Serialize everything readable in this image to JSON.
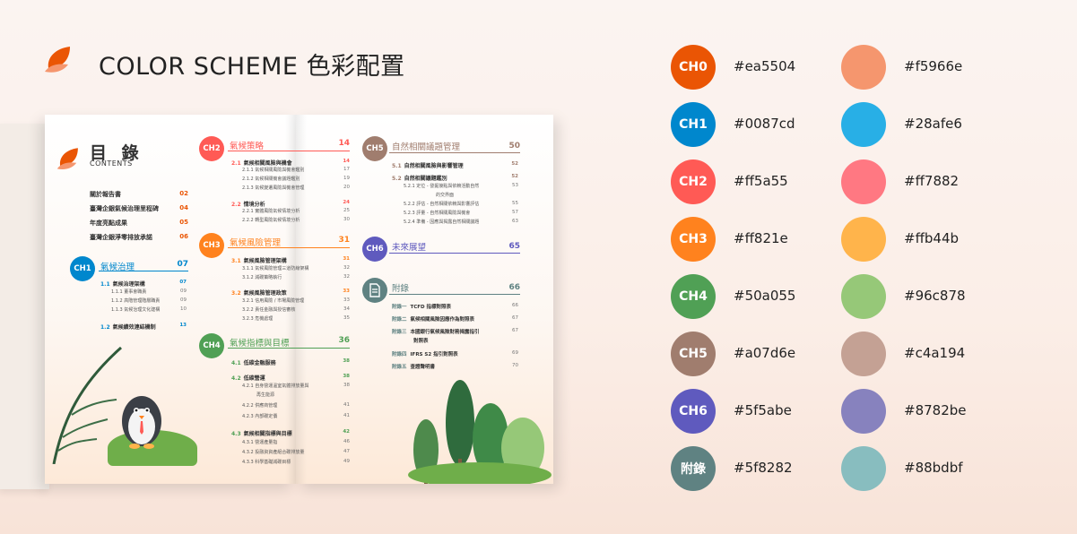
{
  "header": {
    "title": "COLOR SCHEME 色彩配置"
  },
  "palette": [
    {
      "label": "CH0",
      "primary": "#ea5504",
      "light": "#f5966e"
    },
    {
      "label": "CH1",
      "primary": "#0087cd",
      "light": "#28afe6"
    },
    {
      "label": "CH2",
      "primary": "#ff5a55",
      "light": "#ff7882"
    },
    {
      "label": "CH3",
      "primary": "#ff821e",
      "light": "#ffb44b"
    },
    {
      "label": "CH4",
      "primary": "#50a055",
      "light": "#96c878"
    },
    {
      "label": "CH5",
      "primary": "#a07d6e",
      "light": "#c4a194"
    },
    {
      "label": "CH6",
      "primary": "#5f5abe",
      "light": "#8782be"
    },
    {
      "label": "附錄",
      "primary": "#5f8282",
      "light": "#88bdbf"
    }
  ],
  "book": {
    "toc_heading": "目 錄",
    "toc_sub": "CONTENTS",
    "intro_items": [
      {
        "label": "關於報告書",
        "page": "02"
      },
      {
        "label": "臺灣企銀氣候治理里程碑",
        "page": "04"
      },
      {
        "label": "年度亮點成果",
        "page": "05"
      },
      {
        "label": "臺灣企銀淨零排放承諾",
        "page": "06"
      }
    ],
    "chapters": {
      "ch1": {
        "badge": "CH1",
        "title": "氣候治理",
        "page": "07",
        "sections": [
          {
            "num": "1.1",
            "title": "氣候治理架構",
            "page": "07",
            "subs": [
              {
                "title": "1.1.1 董事會職責",
                "page": "09"
              },
              {
                "title": "1.1.2 高階管理階層職責",
                "page": "09"
              },
              {
                "title": "1.1.3 氣候治理文化建構",
                "page": "10"
              }
            ]
          },
          {
            "num": "1.2",
            "title": "氣候績效連結機制",
            "page": "13",
            "subs": []
          }
        ]
      },
      "ch2": {
        "badge": "CH2",
        "title": "氣候策略",
        "page": "14",
        "sections": [
          {
            "num": "2.1",
            "title": "氣候相關風險與機會",
            "page": "14",
            "subs": [
              {
                "title": "2.1.1 氣候相關風險與機會鑑別",
                "page": "17"
              },
              {
                "title": "2.1.2 氣候相關機會議題鑑別",
                "page": "19"
              },
              {
                "title": "2.1.3 氣候變遷風險與機會管理",
                "page": "20"
              }
            ]
          },
          {
            "num": "2.2",
            "title": "情境分析",
            "page": "24",
            "subs": [
              {
                "title": "2.2.1 實體風險氣候情境分析",
                "page": "25"
              },
              {
                "title": "2.2.2 轉型風險氣候情境分析",
                "page": "30"
              }
            ]
          }
        ]
      },
      "ch3": {
        "badge": "CH3",
        "title": "氣候風險管理",
        "page": "31",
        "sections": [
          {
            "num": "3.1",
            "title": "氣候風險管理架構",
            "page": "31",
            "subs": [
              {
                "title": "3.1.1 氣候風險管理三道防線架構",
                "page": "32"
              },
              {
                "title": "3.1.2 減碳策略執行",
                "page": "32"
              }
            ]
          },
          {
            "num": "3.2",
            "title": "氣候風險管理政策",
            "page": "33",
            "subs": [
              {
                "title": "3.2.1 信用風險 / 市場風險管理",
                "page": "33"
              },
              {
                "title": "3.2.2 責任金融與授信審核",
                "page": "34"
              },
              {
                "title": "3.2.3 危機處理",
                "page": "35"
              }
            ]
          }
        ]
      },
      "ch4": {
        "badge": "CH4",
        "title": "氣候指標與目標",
        "page": "36",
        "sections": [
          {
            "num": "4.1",
            "title": "低碳金融服務",
            "page": "38",
            "subs": []
          },
          {
            "num": "4.2",
            "title": "低碳營運",
            "page": "38",
            "subs": [
              {
                "title": "4.2.1 自身營運溫室氣體排放量與",
                "page": "38"
              },
              {
                "title": "再生能源",
                "page": ""
              },
              {
                "title": "4.2.2 供應商管理",
                "page": "41"
              },
              {
                "title": "4.2.3 內部碳定價",
                "page": "41"
              }
            ]
          },
          {
            "num": "4.3",
            "title": "氣候相關指標與目標",
            "page": "42",
            "subs": [
              {
                "title": "4.3.1 營運產量指",
                "page": "46"
              },
              {
                "title": "4.3.2 投融資資產組合碳排放量",
                "page": "47"
              },
              {
                "title": "4.3.3 科學基礎減碳目標",
                "page": "49"
              }
            ]
          }
        ]
      },
      "ch5": {
        "badge": "CH5",
        "title": "自然相關議題管理",
        "page": "50",
        "sections": [
          {
            "num": "5.1",
            "title": "自然相關風險與影響管理",
            "page": "52",
            "subs": []
          },
          {
            "num": "5.2",
            "title": "自然相關議題鑑別",
            "page": "52",
            "subs": [
              {
                "title": "5.2.1 定位 - 發掘接點與依賴活動自然",
                "page": "53"
              },
              {
                "title": "的交界面",
                "page": ""
              },
              {
                "title": "5.2.2 評估 - 自然相關依賴與影響評估",
                "page": "55"
              },
              {
                "title": "5.2.3 評量 - 自然相關風險與機會",
                "page": "57"
              },
              {
                "title": "5.2.4 準備 - 因應與揭露自然相關議題",
                "page": "63"
              }
            ]
          }
        ]
      },
      "ch6": {
        "badge": "CH6",
        "title": "未來展望",
        "page": "65"
      },
      "appendix": {
        "title": "附錄",
        "page": "66",
        "items": [
          {
            "num": "附錄一",
            "title": "TCFD 指標對照表",
            "page": "66"
          },
          {
            "num": "附錄二",
            "title": "氣候相關風險因應作為對照表",
            "page": "67"
          },
          {
            "num": "附錄三",
            "title": "本國銀行氣候風險財務揭露指引",
            "page": "67"
          },
          {
            "num": "",
            "title": "對照表",
            "page": ""
          },
          {
            "num": "附錄四",
            "title": "IFRS S2 指引對照表",
            "page": "69"
          },
          {
            "num": "附錄五",
            "title": "查證聲明書",
            "page": "70"
          }
        ]
      }
    }
  },
  "colors": {
    "accent": "#ea5504",
    "text": "#222222"
  }
}
